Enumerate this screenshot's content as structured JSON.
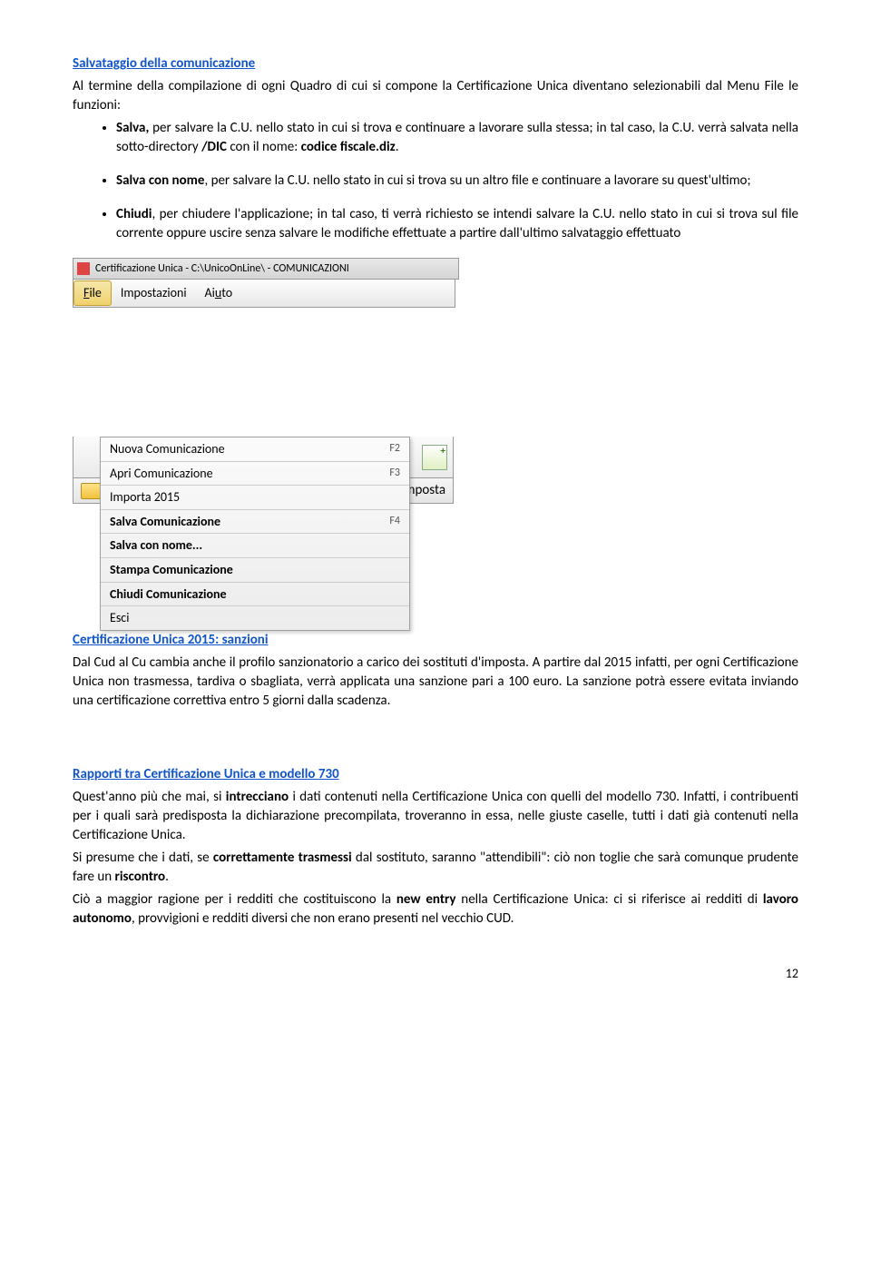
{
  "section1": {
    "title": "Salvataggio della comunicazione",
    "intro": "Al termine della compilazione di ogni Quadro di cui si compone la Certificazione Unica diventano selezionabili dal Menu File le funzioni:",
    "bullet1_prefix": "Salva,",
    "bullet1_rest": " per salvare la C.U. nello stato in cui si trova e continuare a lavorare sulla stessa; in tal caso, la C.U. verrà salvata nella sotto-directory ",
    "bullet1_bold2": "/DIC",
    "bullet1_rest2": " con il nome: ",
    "bullet1_bold3": "codice fiscale.diz",
    "bullet1_end": ".",
    "bullet2_prefix": "Salva con nome",
    "bullet2_rest": ", per salvare la C.U. nello stato in cui si trova su un altro file e continuare a lavorare su quest'ultimo;",
    "bullet3_prefix": "Chiudi",
    "bullet3_rest": ", per chiudere l'applicazione; in tal caso, ti verrà richiesto se intendi salvare la C.U. nello stato in cui si trova sul file corrente oppure uscire senza salvare le modifiche effettuate a partire dall'ultimo salvataggio effettuato"
  },
  "app": {
    "title": "Certificazione Unica - C:\\UnicoOnLine\\ - COMUNICAZIONI",
    "menu_file_f": "F",
    "menu_file_rest": "ile",
    "menu_imp": "Impostazioni",
    "menu_aiuto_a": "A",
    "menu_aiuto_i": "i",
    "menu_aiuto_u": "u",
    "menu_aiuto_to": "to",
    "dropdown": [
      {
        "label": "Nuova Comunicazione",
        "shortcut": "F2",
        "bold": false
      },
      {
        "label": "Apri Comunicazione",
        "shortcut": "F3",
        "bold": false
      },
      {
        "label": "Importa 2015",
        "shortcut": "",
        "bold": false
      },
      {
        "label": "Salva Comunicazione",
        "shortcut": "F4",
        "bold": true
      },
      {
        "label": "Salva con nome...",
        "shortcut": "",
        "bold": true
      },
      {
        "label": "Stampa Comunicazione",
        "shortcut": "",
        "bold": true
      },
      {
        "label": "Chiudi Comunicazione",
        "shortcut": "",
        "bold": true
      },
      {
        "label": "Esci",
        "shortcut": "",
        "bold": false
      }
    ],
    "below_text": "d'Imposta"
  },
  "section2": {
    "title": "Certificazione Unica 2015: sanzioni",
    "para": "Dal Cud al Cu cambia anche il profilo sanzionatorio a carico dei sostituti d'imposta. A partire dal 2015 infatti, per ogni Certificazione Unica non trasmessa, tardiva o sbagliata, verrà applicata una sanzione pari a 100 euro. La sanzione potrà essere evitata inviando una certificazione correttiva entro 5 giorni dalla scadenza."
  },
  "section3": {
    "title": "Rapporti tra Certificazione Unica e modello 730",
    "p1a": "Quest'anno più che mai, si ",
    "p1b": "intrecciano",
    "p1c": " i dati contenuti nella Certificazione Unica con quelli del modello 730. Infatti, i contribuenti per i quali sarà predisposta la dichiarazione precompilata, troveranno in essa, nelle giuste caselle, tutti i dati già contenuti nella Certificazione Unica.",
    "p2a": "Si presume che i dati, se ",
    "p2b": "correttamente trasmessi",
    "p2c": " dal sostituto, saranno \"attendibili\": ciò non toglie che sarà comunque prudente fare un ",
    "p2d": "riscontro",
    "p2e": ".",
    "p3a": "Ciò a maggior ragione per i redditi che costituiscono la ",
    "p3b": "new entry",
    "p3c": " nella Certificazione Unica: ci si riferisce ai redditi di ",
    "p3d": "lavoro autonomo",
    "p3e": ", provvigioni e redditi diversi che non erano presenti nel vecchio CUD."
  },
  "page_number": "12"
}
